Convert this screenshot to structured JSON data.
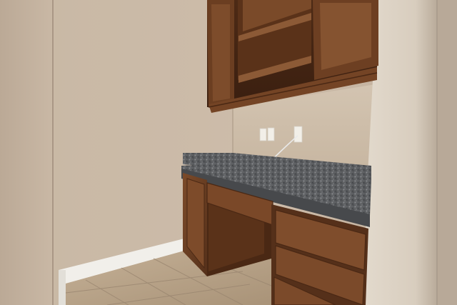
{
  "scene": {
    "kind": "photo",
    "subject": "kitchen-desk-nook",
    "colors": {
      "wall_main": "#cfbfac",
      "wall_shadow": "#b7a793",
      "wall_left": "#c4b3a0",
      "wall_right": "#ddd3c4",
      "cabinet_wood": "#6a3e22",
      "cabinet_wood_dark": "#4a2814",
      "cabinet_wood_light": "#8a5a38",
      "granite": "#595b5e",
      "granite_light": "#7b7d80",
      "tile_floor": "#b9a48a",
      "baseboard": "#f1efea",
      "outlet": "#f2efe8",
      "cable": "#e9e9e9"
    }
  }
}
